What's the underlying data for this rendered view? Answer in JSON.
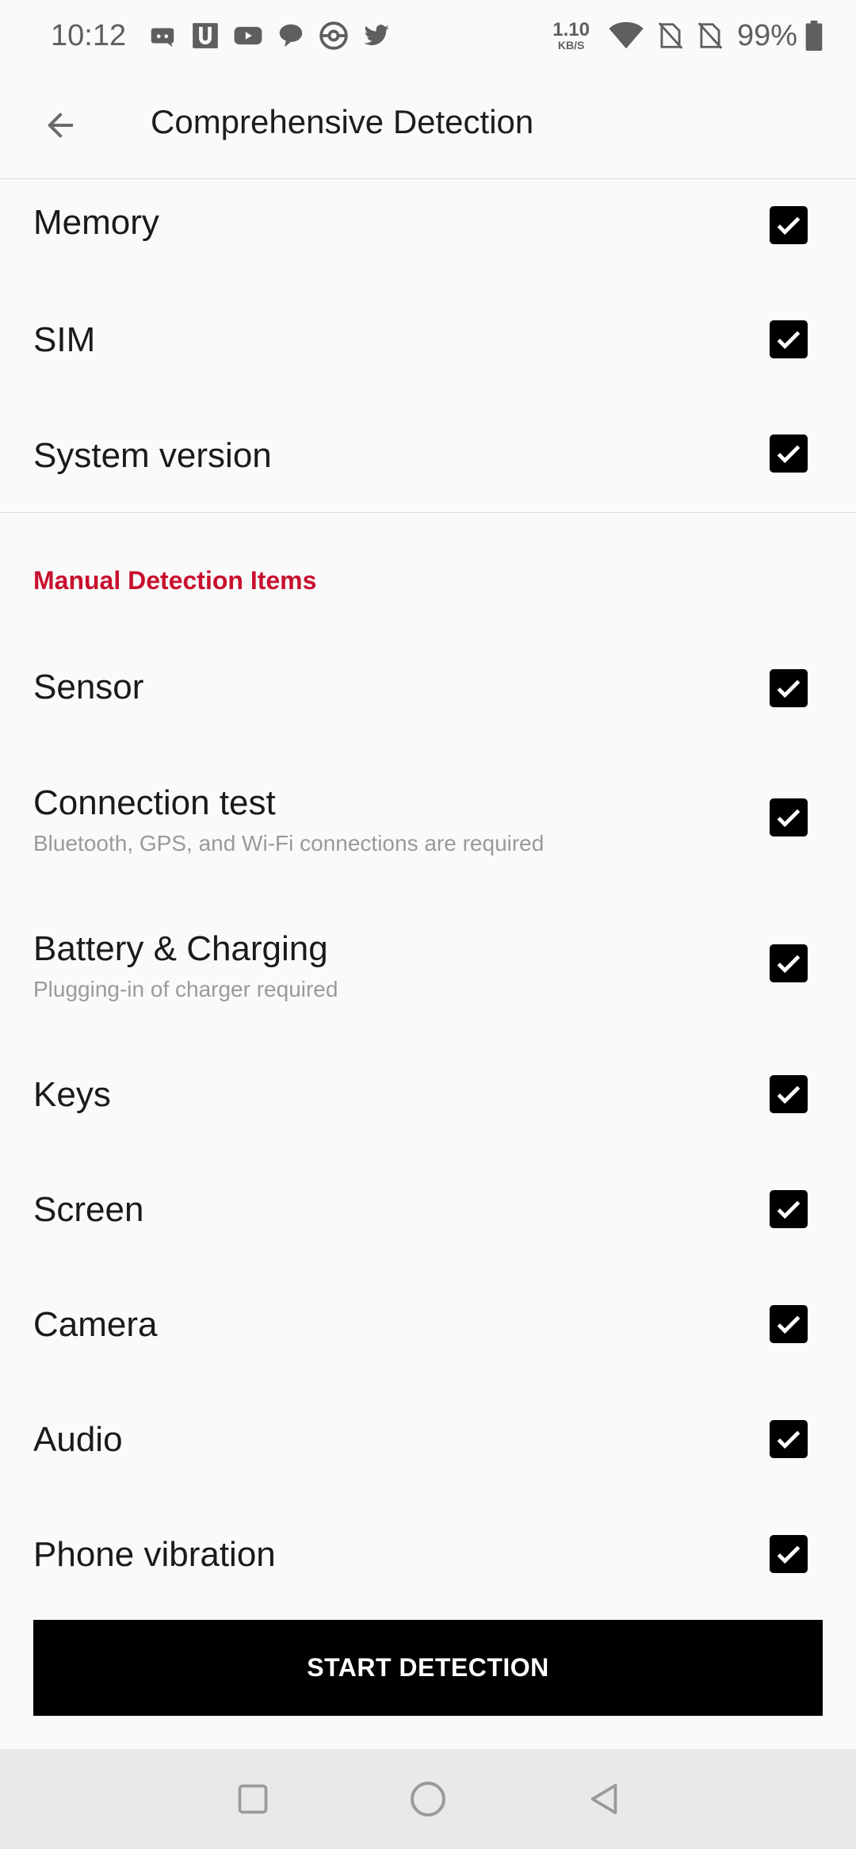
{
  "status_bar": {
    "time": "10:12",
    "notification_icons": [
      "discord-icon",
      "u-app-icon",
      "youtube-icon",
      "chat-bubble-icon",
      "pokeball-icon",
      "twitter-icon"
    ],
    "net_speed_value": "1.10",
    "net_speed_unit": "KB/S",
    "battery_percent": "99%"
  },
  "app_bar": {
    "title": "Comprehensive Detection",
    "back_icon": "back-arrow-icon"
  },
  "auto_items": [
    {
      "label": "Memory",
      "checked": true
    },
    {
      "label": "SIM",
      "checked": true
    },
    {
      "label": "System version",
      "checked": true
    }
  ],
  "manual_section": {
    "header": "Manual Detection Items",
    "items": [
      {
        "label": "Sensor",
        "sub": "",
        "checked": true
      },
      {
        "label": "Connection test",
        "sub": "Bluetooth, GPS, and Wi-Fi connections are required",
        "checked": true
      },
      {
        "label": "Battery & Charging",
        "sub": "Plugging-in of charger required",
        "checked": true
      },
      {
        "label": "Keys",
        "sub": "",
        "checked": true
      },
      {
        "label": "Screen",
        "sub": "",
        "checked": true
      },
      {
        "label": "Camera",
        "sub": "",
        "checked": true
      },
      {
        "label": "Audio",
        "sub": "",
        "checked": true
      },
      {
        "label": "Phone vibration",
        "sub": "",
        "checked": true
      }
    ]
  },
  "start_button_label": "START DETECTION",
  "nav_bar": [
    "recents-square-icon",
    "home-circle-icon",
    "back-triangle-icon"
  ],
  "colors": {
    "accent": "#c8102e",
    "checkbox": "#000000",
    "button": "#000000"
  }
}
